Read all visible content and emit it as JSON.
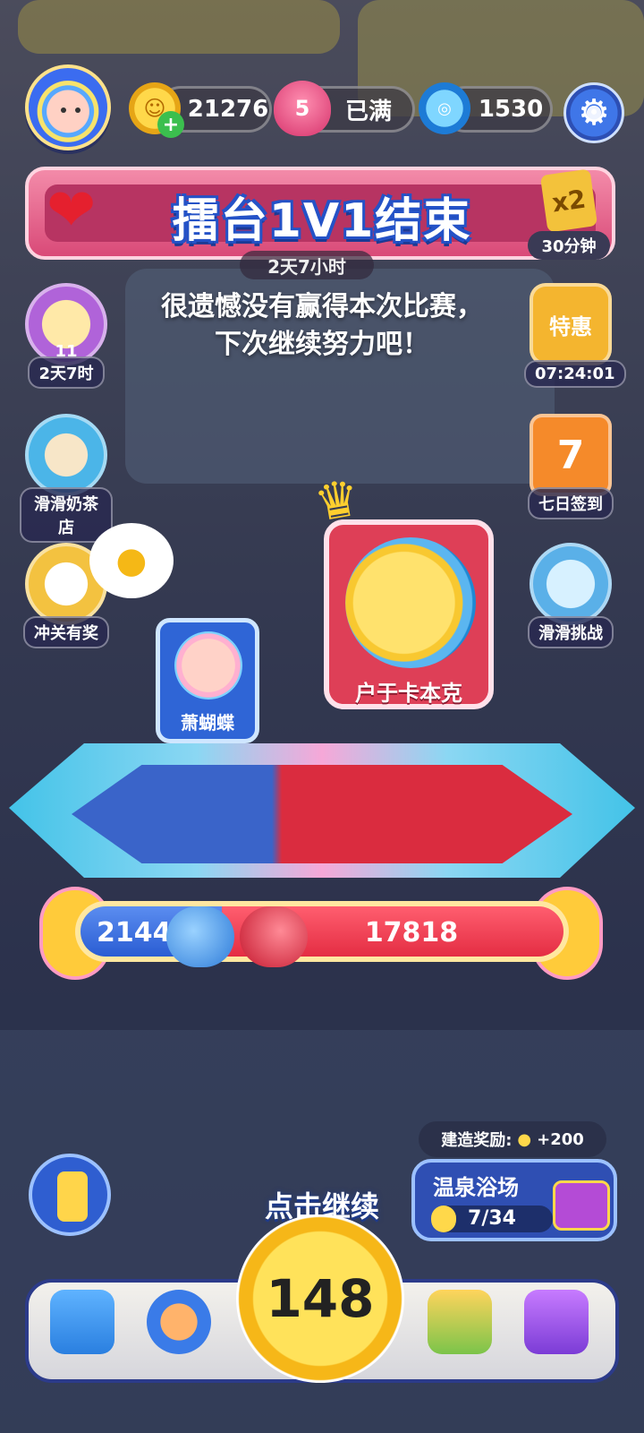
{
  "top_bar": {
    "coins": "21276",
    "lives_count": "5",
    "lives_status": "已满",
    "gems": "1530"
  },
  "banner": {
    "title": "擂台1V1结束",
    "multiplier": "x2",
    "duration": "30分钟",
    "timer": "2天7小时"
  },
  "result_message": {
    "line1": "很遗憾没有赢得本次比赛，",
    "line2": "下次继续努力吧！"
  },
  "left_menu": {
    "item1_count": "11",
    "item1_label": "2天7时",
    "item2_label": "滑滑奶茶店",
    "item3_label": "冲关有奖"
  },
  "right_menu": {
    "item1_badge": "特惠",
    "item1_label": "07:24:01",
    "item2_day": "7",
    "item2_label": "七日签到",
    "item3_label": "滑滑挑战"
  },
  "match": {
    "player_name": "萧蝴蝶",
    "opponent_name": "户于卡本克",
    "player_score": "2144",
    "opponent_score": "17818",
    "player_share": 0.107
  },
  "build": {
    "reward_label": "建造奖励:",
    "reward_amount": "+200",
    "location_name": "温泉浴场",
    "progress_text": "7/34",
    "progress_fraction": 0.206
  },
  "bottom": {
    "tap_continue": "点击继续",
    "center_count": "148"
  },
  "colors": {
    "blue_team": "#2a5dd3",
    "red_team": "#e42d43",
    "gold": "#ffcb3a"
  }
}
